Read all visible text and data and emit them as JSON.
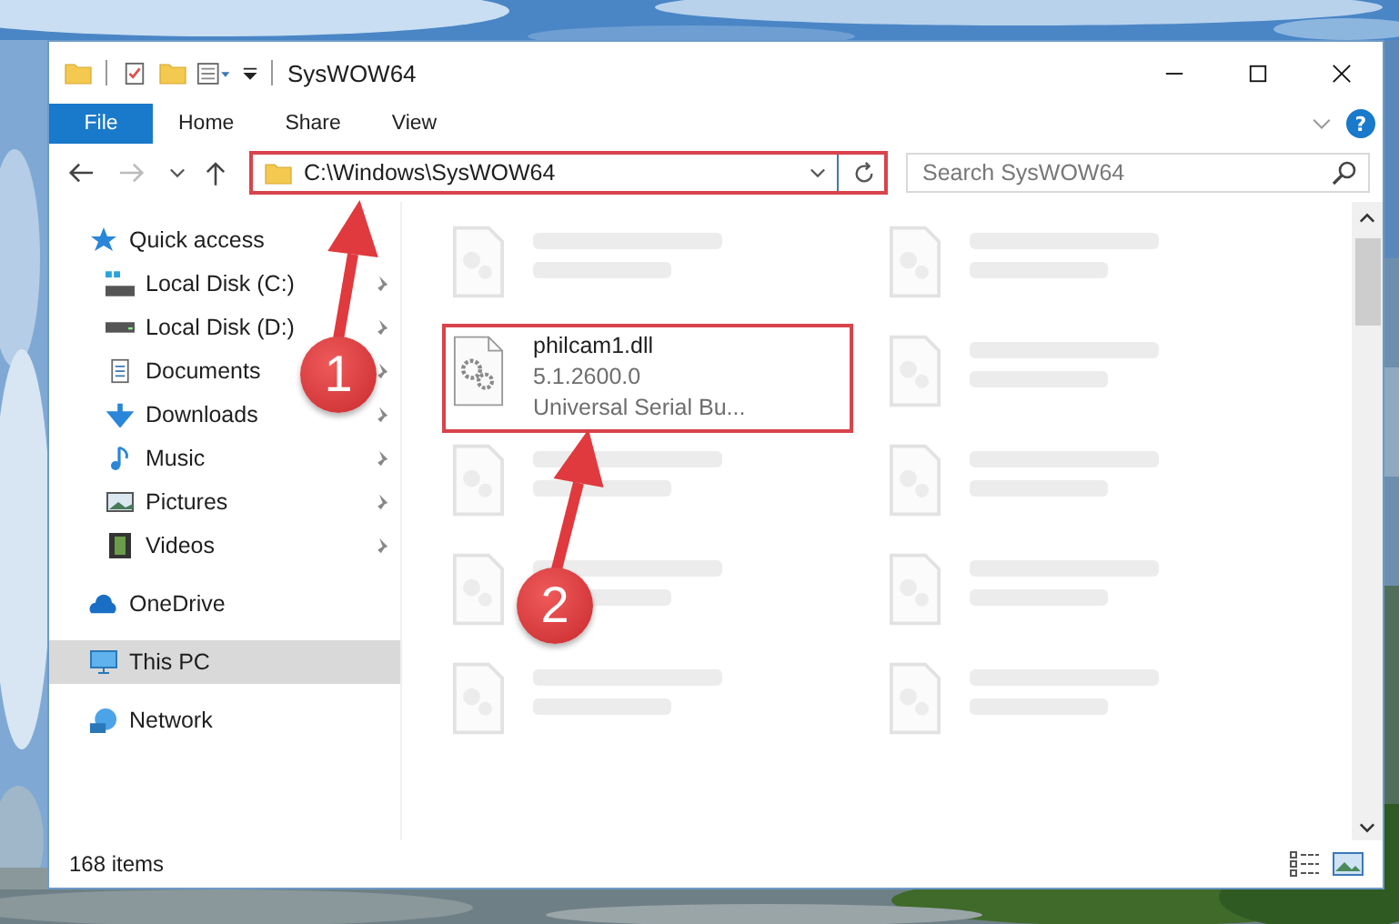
{
  "window": {
    "title": "SysWOW64"
  },
  "ribbon_tabs": [
    {
      "label": "File",
      "kind": "file",
      "selected": false
    },
    {
      "label": "Home",
      "kind": "tab",
      "selected": false
    },
    {
      "label": "Share",
      "kind": "tab",
      "selected": false
    },
    {
      "label": "View",
      "kind": "tab",
      "selected": false
    }
  ],
  "help_button": {
    "label": "?"
  },
  "address_bar": {
    "path": "C:\\Windows\\SysWOW64",
    "highlighted": true
  },
  "search": {
    "placeholder": "Search SysWOW64"
  },
  "sidebar": {
    "items": [
      {
        "label": "Quick access",
        "selected": false,
        "children": [
          {
            "label": "Local Disk (C:)",
            "pinned": true,
            "selected": false
          },
          {
            "label": "Local Disk (D:)",
            "pinned": true,
            "selected": false
          },
          {
            "label": "Documents",
            "pinned": true,
            "selected": false
          },
          {
            "label": "Downloads",
            "pinned": true,
            "selected": false
          },
          {
            "label": "Music",
            "pinned": true,
            "selected": false
          },
          {
            "label": "Pictures",
            "pinned": true,
            "selected": false
          },
          {
            "label": "Videos",
            "pinned": true,
            "selected": false
          }
        ]
      },
      {
        "label": "OneDrive",
        "selected": false
      },
      {
        "label": "This PC",
        "selected": true
      },
      {
        "label": "Network",
        "selected": false
      }
    ]
  },
  "files": [
    {
      "kind": "blurred",
      "highlighted": false
    },
    {
      "kind": "blurred",
      "highlighted": false
    },
    {
      "kind": "file",
      "name": "philcam1.dll",
      "details": [
        "5.1.2600.0",
        "Universal Serial Bu..."
      ],
      "highlighted": true
    },
    {
      "kind": "blurred",
      "highlighted": false
    },
    {
      "kind": "blurred",
      "highlighted": false
    },
    {
      "kind": "blurred",
      "highlighted": false
    },
    {
      "kind": "blurred",
      "highlighted": false
    },
    {
      "kind": "blurred",
      "highlighted": false
    },
    {
      "kind": "blurred",
      "highlighted": false
    },
    {
      "kind": "blurred",
      "highlighted": false
    }
  ],
  "annotations": [
    {
      "label": "1"
    },
    {
      "label": "2"
    }
  ],
  "status_bar": {
    "item_count": "168 items"
  }
}
